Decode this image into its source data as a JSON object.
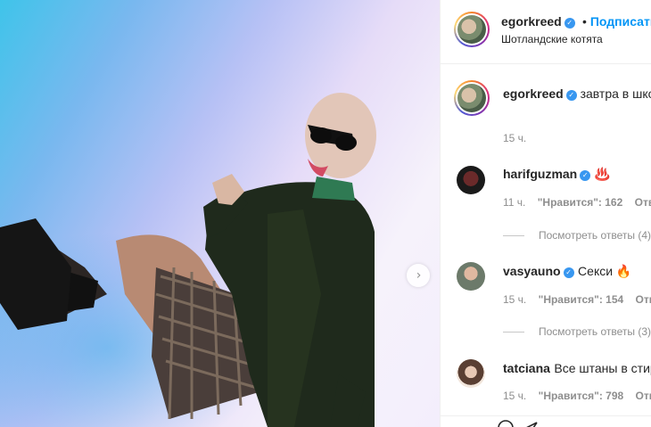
{
  "post": {
    "author": "egorkreed",
    "follow_label": "Подписаться",
    "location": "Шотландские котята",
    "caption": "завтра в школу! С началом учебного года 🏫",
    "caption_time": "15 ч."
  },
  "comments": [
    {
      "user": "harifguzman",
      "verified": true,
      "text": "♨️",
      "time": "11 ч.",
      "likes": "\"Нравится\": 162",
      "reply": "Ответить",
      "view_replies": "Посмотреть ответы (4)"
    },
    {
      "user": "vasyauno",
      "verified": true,
      "text": "Секси 🔥",
      "time": "15 ч.",
      "likes": "\"Нравится\": 154",
      "reply": "Ответить",
      "view_replies": "Посмотреть ответы (3)"
    },
    {
      "user": "tatciana",
      "verified": false,
      "text": "Все штаны в стирке",
      "time": "15 ч.",
      "likes": "\"Нравится\": 798",
      "reply": "Ответить"
    }
  ],
  "icons": {
    "verified": "verified-badge-icon",
    "next": "chevron-right-icon"
  },
  "colors": {
    "link": "#0095f6",
    "verified": "#3897f0",
    "muted": "#8e8e8e"
  }
}
